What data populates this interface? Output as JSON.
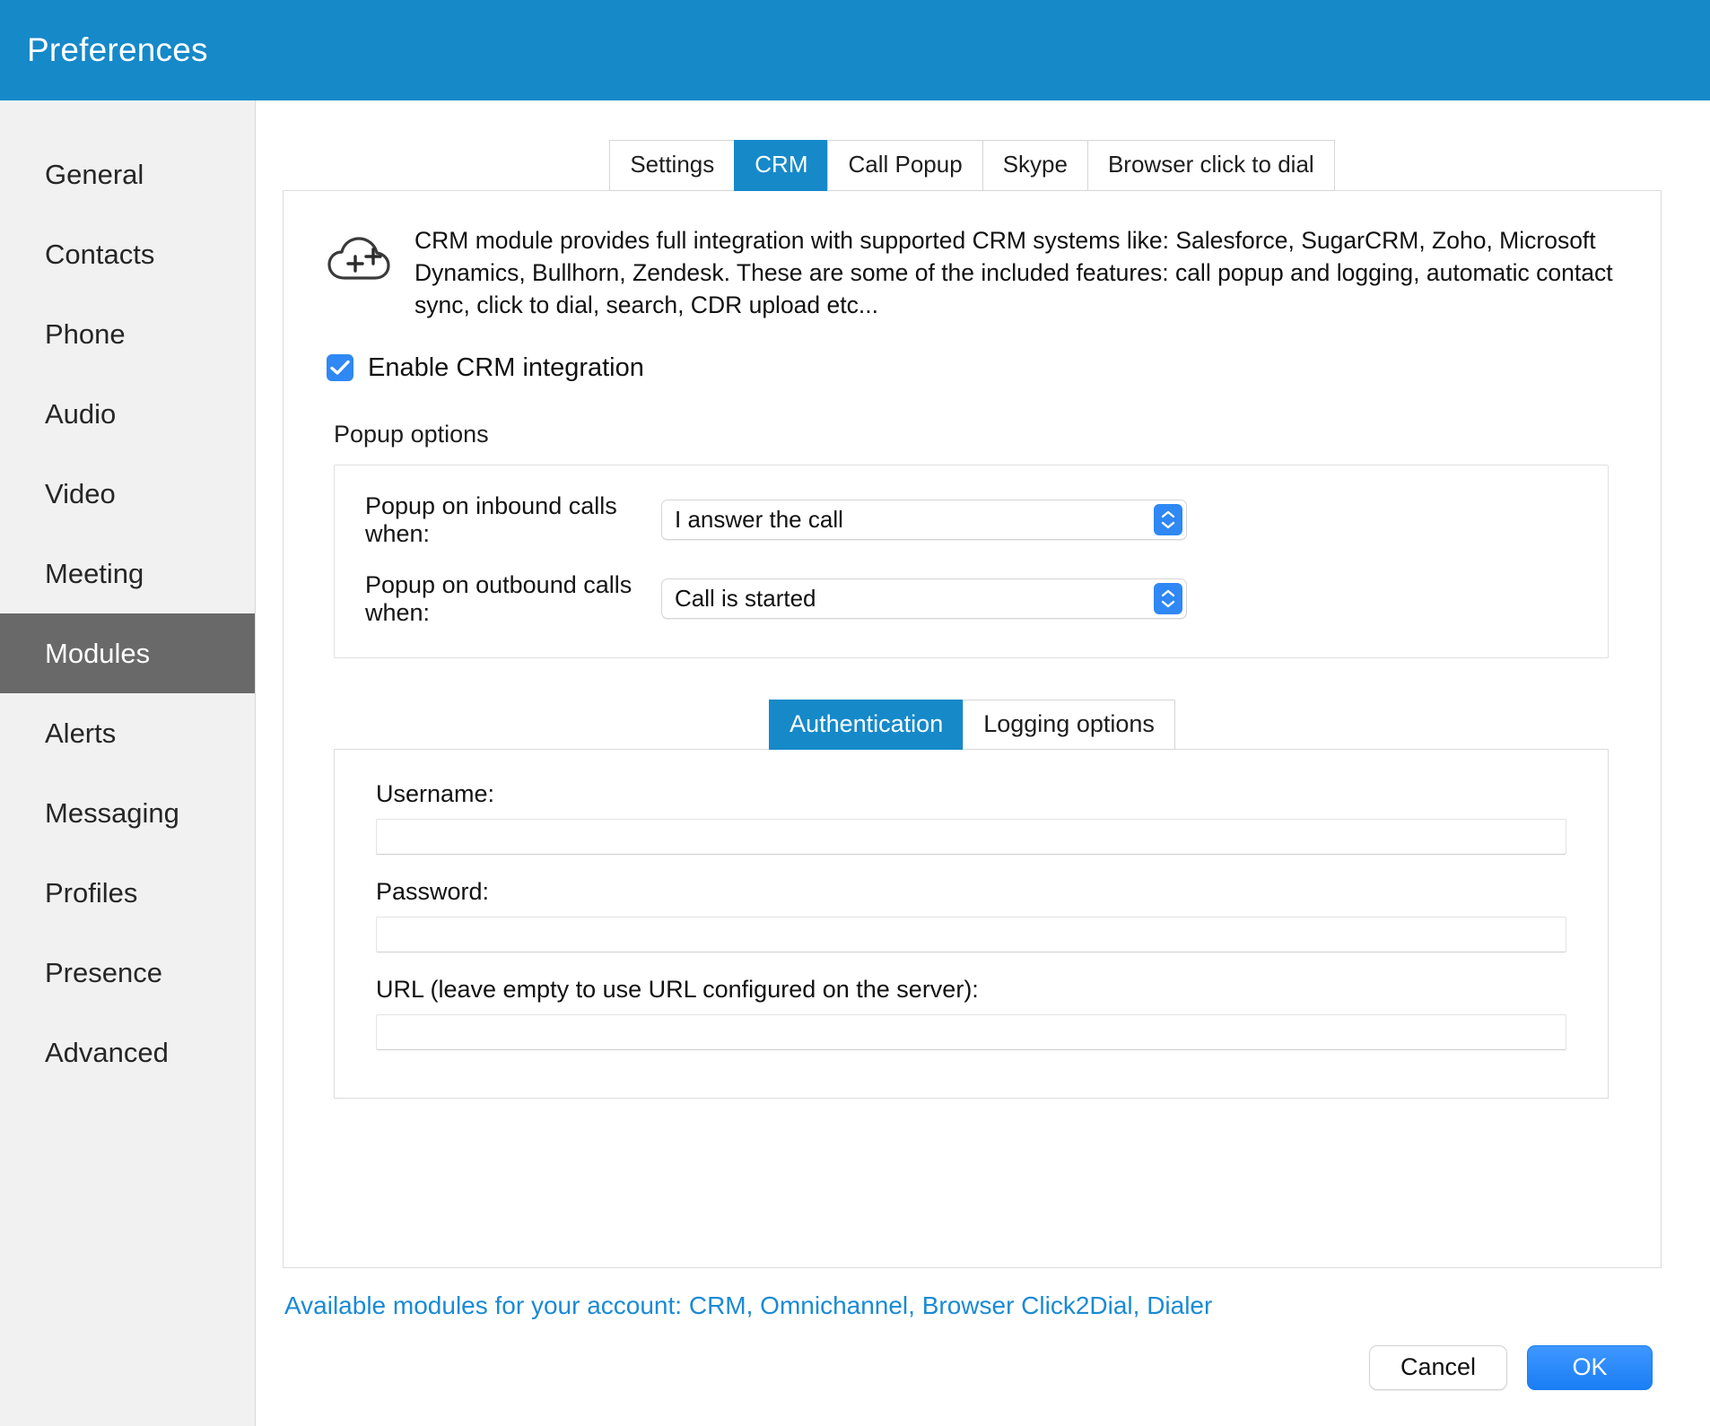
{
  "window": {
    "title": "Preferences",
    "accent_color": "#1689c9",
    "sidebar_active_color": "#69696a",
    "link_color": "#1a8ad4"
  },
  "sidebar": {
    "items": [
      {
        "label": "General",
        "active": false
      },
      {
        "label": "Contacts",
        "active": false
      },
      {
        "label": "Phone",
        "active": false
      },
      {
        "label": "Audio",
        "active": false
      },
      {
        "label": "Video",
        "active": false
      },
      {
        "label": "Meeting",
        "active": false
      },
      {
        "label": "Modules",
        "active": true
      },
      {
        "label": "Alerts",
        "active": false
      },
      {
        "label": "Messaging",
        "active": false
      },
      {
        "label": "Profiles",
        "active": false
      },
      {
        "label": "Presence",
        "active": false
      },
      {
        "label": "Advanced",
        "active": false
      }
    ]
  },
  "tabs": [
    {
      "label": "Settings",
      "active": false
    },
    {
      "label": "CRM",
      "active": true
    },
    {
      "label": "Call Popup",
      "active": false
    },
    {
      "label": "Skype",
      "active": false
    },
    {
      "label": "Browser click to dial",
      "active": false
    }
  ],
  "crm": {
    "icon": "cloud-plus-icon",
    "description": "CRM module provides full integration with supported CRM systems like: Salesforce, SugarCRM, Zoho, Microsoft Dynamics, Bullhorn, Zendesk. These are some of the included features: call popup and logging, automatic contact sync, click to dial, search, CDR upload etc...",
    "enable": {
      "label": "Enable CRM integration",
      "checked": true
    },
    "popup_options": {
      "title": "Popup options",
      "inbound": {
        "label": "Popup on inbound calls when:",
        "value": "I answer the call"
      },
      "outbound": {
        "label": "Popup on outbound calls when:",
        "value": "Call is started"
      }
    },
    "subtabs": [
      {
        "label": "Authentication",
        "active": true
      },
      {
        "label": "Logging options",
        "active": false
      }
    ],
    "authentication": {
      "username": {
        "label": "Username:",
        "value": "",
        "placeholder": ""
      },
      "password": {
        "label": "Password:",
        "value": "",
        "placeholder": ""
      },
      "url": {
        "label": "URL (leave empty to use URL configured on the server):",
        "value": "",
        "placeholder": ""
      }
    }
  },
  "footer": {
    "modules_link": "Available modules for your account: CRM, Omnichannel, Browser Click2Dial, Dialer",
    "cancel_label": "Cancel",
    "ok_label": "OK"
  }
}
